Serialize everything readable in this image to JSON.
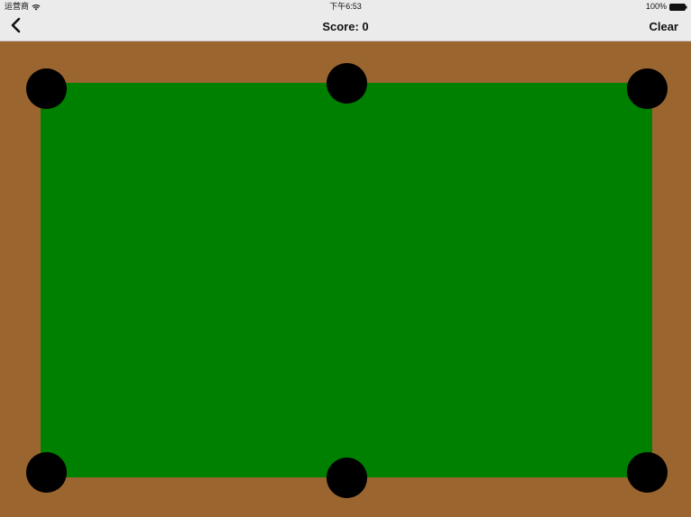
{
  "status_bar": {
    "carrier": "运营商",
    "time": "下午6:53",
    "battery": "100%",
    "wifi_icon": "wifi-icon",
    "battery_icon": "battery-icon"
  },
  "nav_bar": {
    "back_icon": "chevron-left-icon",
    "title": "Score: 0",
    "clear_label": "Clear"
  },
  "table": {
    "felt_color": "#008000",
    "rail_color": "#9b652f",
    "pocket_color": "#000000",
    "pockets": [
      "top-left",
      "top-middle",
      "top-right",
      "bottom-left",
      "bottom-middle",
      "bottom-right"
    ]
  }
}
